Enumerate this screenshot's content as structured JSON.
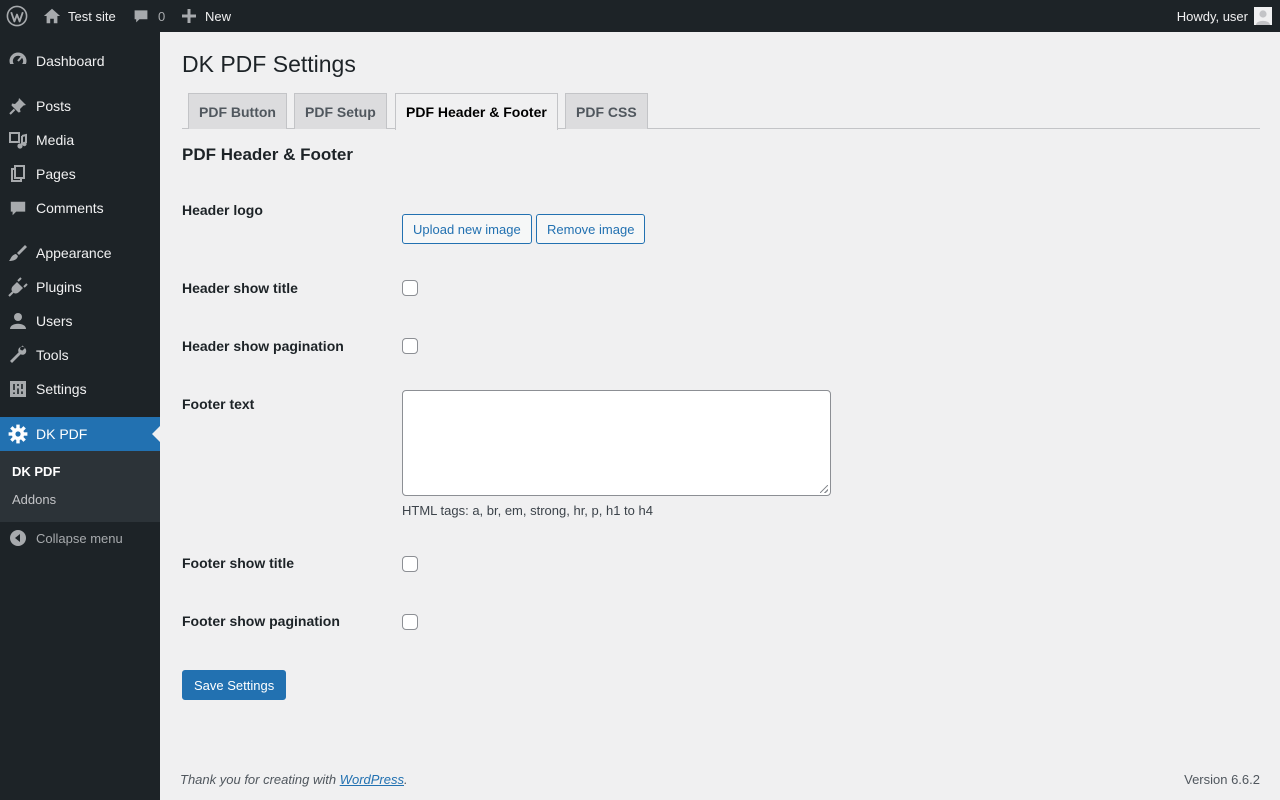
{
  "adminbar": {
    "site_name": "Test site",
    "comments_count": "0",
    "new_label": "New",
    "howdy": "Howdy, user"
  },
  "sidebar": {
    "items": [
      {
        "label": "Dashboard",
        "icon": "dashboard-icon"
      },
      {
        "label": "Posts",
        "icon": "pin-icon"
      },
      {
        "label": "Media",
        "icon": "media-icon"
      },
      {
        "label": "Pages",
        "icon": "pages-icon"
      },
      {
        "label": "Comments",
        "icon": "comment-icon"
      },
      {
        "label": "Appearance",
        "icon": "brush-icon"
      },
      {
        "label": "Plugins",
        "icon": "plug-icon"
      },
      {
        "label": "Users",
        "icon": "user-icon"
      },
      {
        "label": "Tools",
        "icon": "wrench-icon"
      },
      {
        "label": "Settings",
        "icon": "settings-icon"
      },
      {
        "label": "DK PDF",
        "icon": "gear-icon",
        "current": true
      }
    ],
    "submenu": [
      {
        "label": "DK PDF",
        "current": true
      },
      {
        "label": "Addons"
      }
    ],
    "collapse_label": "Collapse menu"
  },
  "page": {
    "title": "DK PDF Settings",
    "tabs": [
      {
        "label": "PDF Button"
      },
      {
        "label": "PDF Setup"
      },
      {
        "label": "PDF Header & Footer",
        "active": true
      },
      {
        "label": "PDF CSS"
      }
    ],
    "section_title": "PDF Header & Footer",
    "fields": {
      "header_logo": {
        "label": "Header logo",
        "upload_label": "Upload new image",
        "remove_label": "Remove image"
      },
      "header_show_title": {
        "label": "Header show title",
        "checked": false
      },
      "header_show_pagination": {
        "label": "Header show pagination",
        "checked": false
      },
      "footer_text": {
        "label": "Footer text",
        "value": "",
        "help": "HTML tags: a, br, em, strong, hr, p, h1 to h4"
      },
      "footer_show_title": {
        "label": "Footer show title",
        "checked": false
      },
      "footer_show_pagination": {
        "label": "Footer show pagination",
        "checked": false
      }
    },
    "save_label": "Save Settings"
  },
  "footer": {
    "thanks_prefix": "Thank you for creating with ",
    "thanks_link": "WordPress",
    "thanks_suffix": ".",
    "version": "Version 6.6.2"
  },
  "colors": {
    "admin_dark": "#1d2327",
    "accent": "#2271b1",
    "background": "#f0f0f1",
    "submenu_bg": "#2c3338"
  }
}
